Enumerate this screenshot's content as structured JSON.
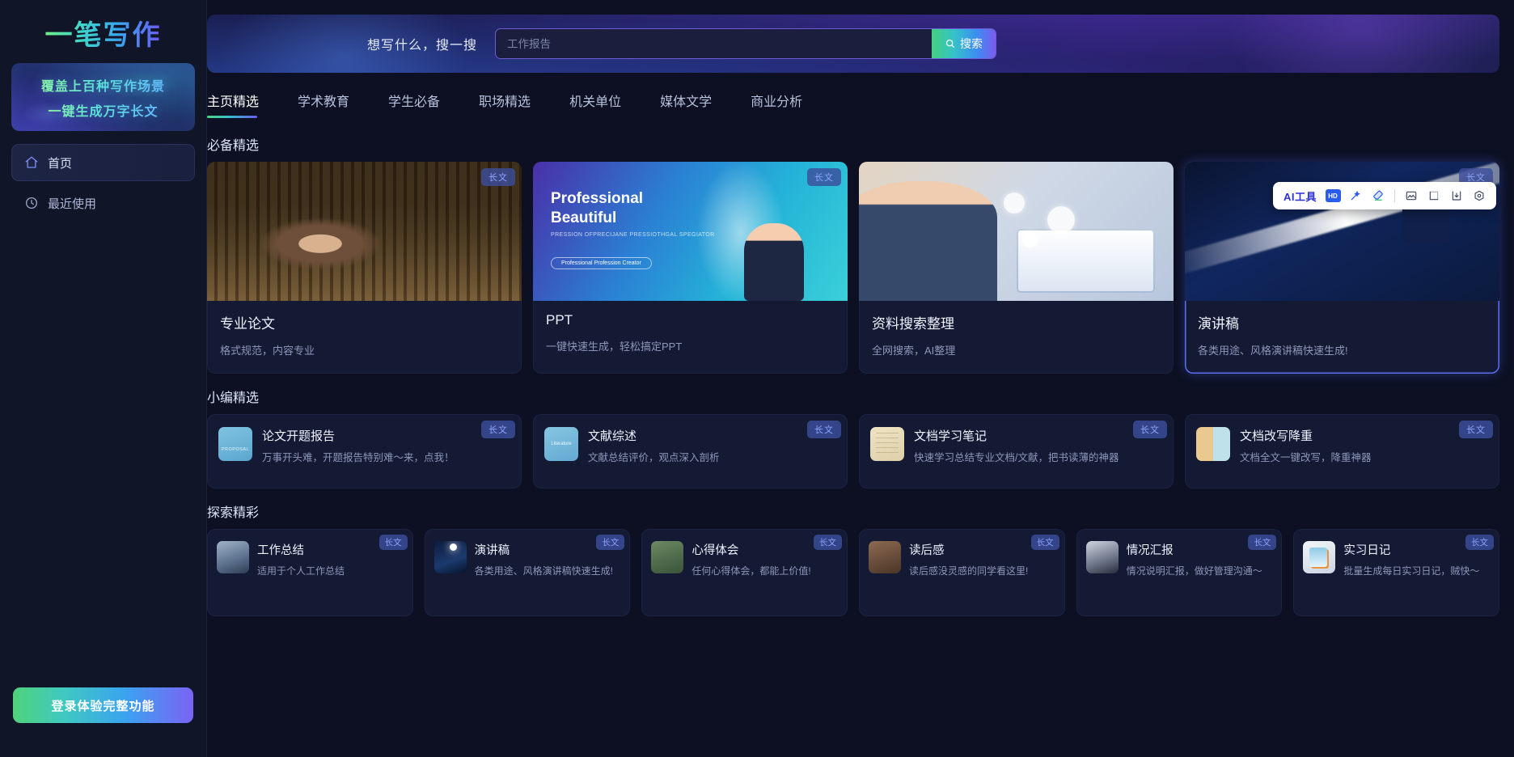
{
  "sidebar": {
    "logo": "一笔写作",
    "promo": {
      "line1": "覆盖上百种写作场景",
      "line2": "一键生成万字长文"
    },
    "nav": [
      {
        "label": "首页",
        "icon": "home-icon",
        "active": true
      },
      {
        "label": "最近使用",
        "icon": "clock-icon",
        "active": false
      }
    ],
    "login_label": "登录体验完整功能"
  },
  "hero": {
    "prompt_label": "想写什么，搜一搜",
    "search_placeholder": "工作报告",
    "search_value": "",
    "search_button": "搜索"
  },
  "tabs": [
    {
      "label": "主页精选",
      "active": true
    },
    {
      "label": "学术教育",
      "active": false
    },
    {
      "label": "学生必备",
      "active": false
    },
    {
      "label": "职场精选",
      "active": false
    },
    {
      "label": "机关单位",
      "active": false
    },
    {
      "label": "媒体文学",
      "active": false
    },
    {
      "label": "商业分析",
      "active": false
    }
  ],
  "ai_toolbar": {
    "label": "AI工具",
    "hd_label": "HD",
    "icons": [
      "hd-icon",
      "magic-wand-icon",
      "eraser-icon",
      "image-edit-icon",
      "crop-icon",
      "download-icon",
      "settings-icon"
    ]
  },
  "badge_label": "长文",
  "sections": [
    {
      "title": "必备精选",
      "type": "featured",
      "cards": [
        {
          "name": "专业论文",
          "desc": "格式规范，内容专业",
          "badge": "长文",
          "art": "library",
          "selected": false
        },
        {
          "name": "PPT",
          "desc": "一键快速生成，轻松搞定PPT",
          "badge": "长文",
          "art": "ppt",
          "selected": false,
          "slide": {
            "title_line1": "Professional",
            "title_line2": "Beautiful",
            "sub": "PRESSION OFPRECIJANE PRESSIOTHGAL SPEGIATOR",
            "pill": "Professional Profession Creator"
          }
        },
        {
          "name": "资料搜索整理",
          "desc": "全网搜索，AI整理",
          "badge": "",
          "art": "data",
          "selected": false
        },
        {
          "name": "演讲稿",
          "desc": "各类用途、风格演讲稿快速生成!",
          "badge": "长文",
          "art": "speech",
          "selected": true
        }
      ]
    },
    {
      "title": "小编精选",
      "type": "picks",
      "cards": [
        {
          "name": "论文开题报告",
          "desc": "万事开头难，开题报告特别难～来，点我！",
          "badge": "长文",
          "thumb": "th-proposal",
          "thumb_text": "PROPOSAL"
        },
        {
          "name": "文献综述",
          "desc": "文献总结评价，观点深入剖析",
          "badge": "长文",
          "thumb": "th-lit",
          "thumb_text": "Literature"
        },
        {
          "name": "文档学习笔记",
          "desc": "快速学习总结专业文档/文献，把书读薄的神器",
          "badge": "长文",
          "thumb": "th-note",
          "thumb_text": ""
        },
        {
          "name": "文档改写降重",
          "desc": "文档全文一键改写，降重神器",
          "badge": "长文",
          "thumb": "th-rewrite",
          "thumb_text": ""
        }
      ]
    },
    {
      "title": "探索精彩",
      "type": "explore",
      "cards": [
        {
          "name": "工作总结",
          "desc": "适用于个人工作总结",
          "badge": "长文",
          "thumb": "t-work"
        },
        {
          "name": "演讲稿",
          "desc": "各类用途、风格演讲稿快速生成!",
          "badge": "长文",
          "thumb": "t-speech"
        },
        {
          "name": "心得体会",
          "desc": "任何心得体会，都能上价值!",
          "badge": "长文",
          "thumb": "t-exp"
        },
        {
          "name": "读后感",
          "desc": "读后感没灵感的同学看这里!",
          "badge": "长文",
          "thumb": "t-read"
        },
        {
          "name": "情况汇报",
          "desc": "情况说明汇报，做好管理沟通～",
          "badge": "长文",
          "thumb": "t-report"
        },
        {
          "name": "实习日记",
          "desc": "批量生成每日实习日记，贼快～",
          "badge": "长文",
          "thumb": "t-diary"
        }
      ]
    }
  ],
  "colors": {
    "accent_green": "#4fd37a",
    "accent_cyan": "#35c2c9",
    "accent_blue": "#3aa3ef",
    "accent_purple": "#7b63f6",
    "badge_text": "#8ea4ff",
    "page_bg": "#0c1022",
    "sidebar_bg": "#101528",
    "card_bg": "#141a34"
  }
}
